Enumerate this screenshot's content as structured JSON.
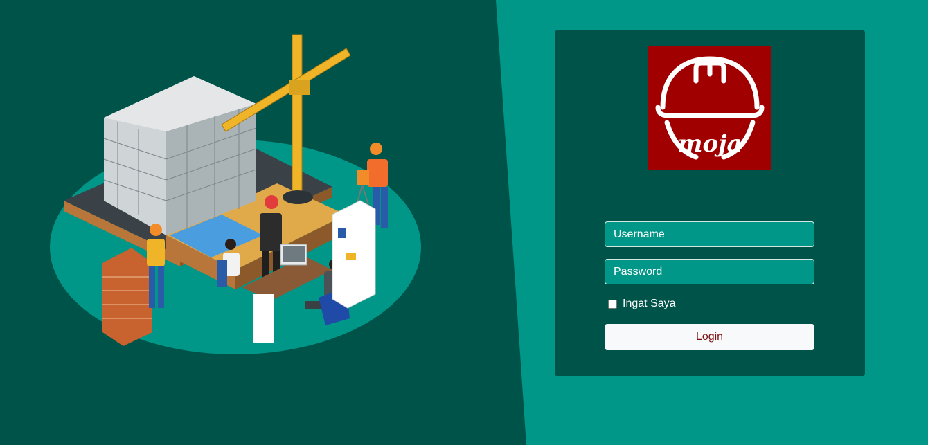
{
  "login_form": {
    "username_placeholder": "Username",
    "password_placeholder": "Password",
    "remember_label": "Ingat Saya",
    "login_label": "Login"
  },
  "logo": {
    "text": "moja",
    "background_color": "#a00000"
  },
  "colors": {
    "primary_dark": "#005349",
    "primary": "#009688",
    "button_bg": "#f8f9fa",
    "button_text": "#7a1010"
  },
  "illustration": {
    "name": "construction-site-illustration"
  }
}
